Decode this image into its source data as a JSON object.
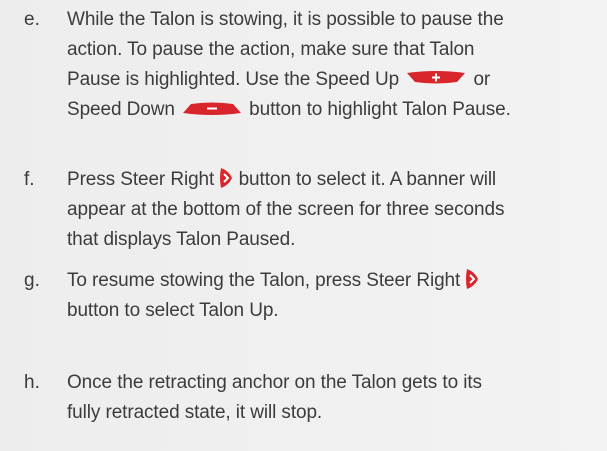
{
  "steps": [
    {
      "letter": "e.",
      "line1": "While the Talon is stowing, it is possible to pause the",
      "line2": "action. To pause the action, make sure that Talon",
      "line3a": "Pause is highlighted. Use the Speed Up",
      "line3b": "or",
      "line4a": "Speed Down",
      "line4b": "button to highlight Talon Pause."
    },
    {
      "letter": "f.",
      "line1a": "Press Steer Right",
      "line1b": "button to select it. A banner will",
      "line2": "appear at the bottom of the screen for three seconds",
      "line3": "that displays Talon Paused."
    },
    {
      "letter": "g.",
      "line1a": "To resume stowing the Talon, press Steer Right",
      "line2": "button to select Talon Up."
    },
    {
      "letter": "h.",
      "line1": "Once the retracting anchor on the Talon gets to its",
      "line2": "fully retracted state, it will stop."
    }
  ],
  "icons": {
    "speed_up": "speed-up-icon",
    "speed_down": "speed-down-icon",
    "steer_right": "steer-right-icon"
  },
  "colors": {
    "icon_red": "#d8262c",
    "text": "#3c3c3c",
    "background": "#efefef"
  }
}
